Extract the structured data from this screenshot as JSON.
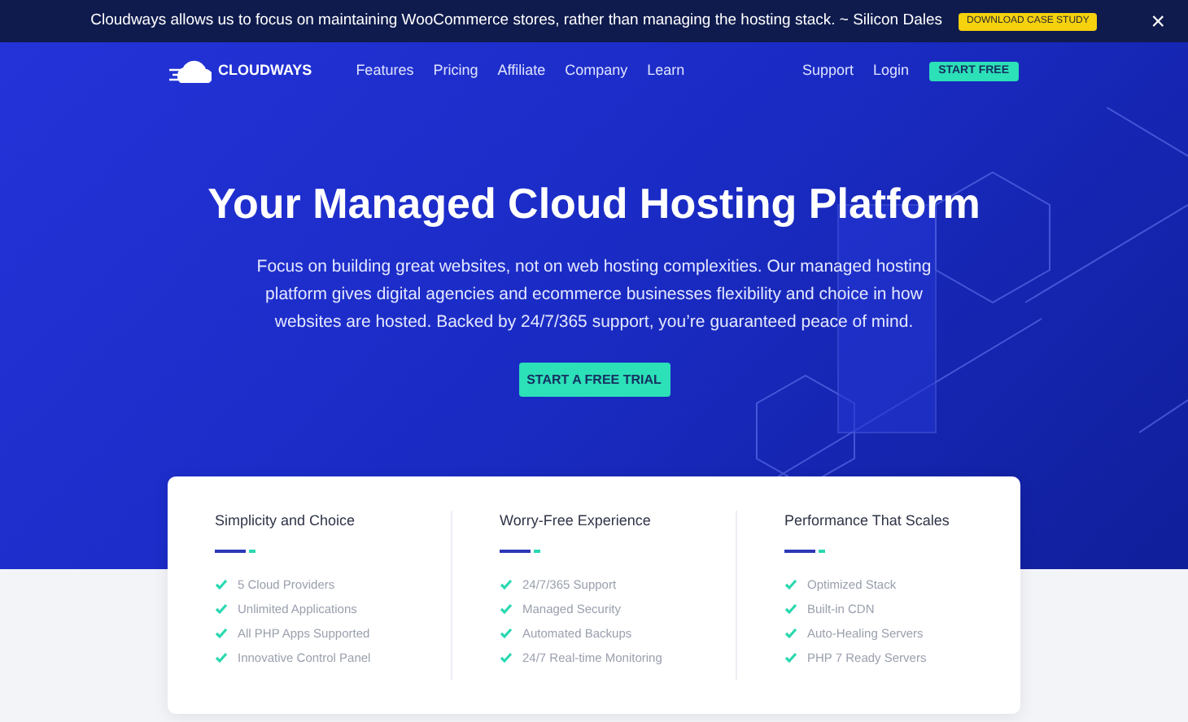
{
  "announcement": {
    "text": "Cloudways allows us to focus on maintaining WooCommerce stores, rather than managing the hosting stack. ~ Silicon Dales",
    "button": "DOWNLOAD CASE STUDY",
    "close": "×"
  },
  "nav": {
    "logo": "CLOUDWAYS",
    "links": [
      "Features",
      "Pricing",
      "Affiliate",
      "Company",
      "Learn"
    ],
    "right_links": [
      "Support",
      "Login"
    ],
    "cta": "START FREE"
  },
  "hero": {
    "title": "Your Managed Cloud Hosting Platform",
    "description": "Focus on building great websites, not on web hosting complexities. Our managed hosting platform gives digital agencies and ecommerce businesses flexibility and choice in how websites are hosted. Backed by 24/7/365 support, you’re guaranteed peace of mind.",
    "button": "START A FREE TRIAL"
  },
  "features": [
    {
      "title": "Simplicity and Choice",
      "items": [
        "5 Cloud Providers",
        "Unlimited Applications",
        "All PHP Apps Supported",
        "Innovative Control Panel"
      ]
    },
    {
      "title": "Worry-Free Experience",
      "items": [
        "24/7/365 Support",
        "Managed Security",
        "Automated Backups",
        "24/7 Real-time Monitoring"
      ]
    },
    {
      "title": "Performance That Scales",
      "items": [
        "Optimized Stack",
        "Built-in CDN",
        "Auto-Healing Servers",
        "PHP 7 Ready Servers"
      ]
    }
  ]
}
